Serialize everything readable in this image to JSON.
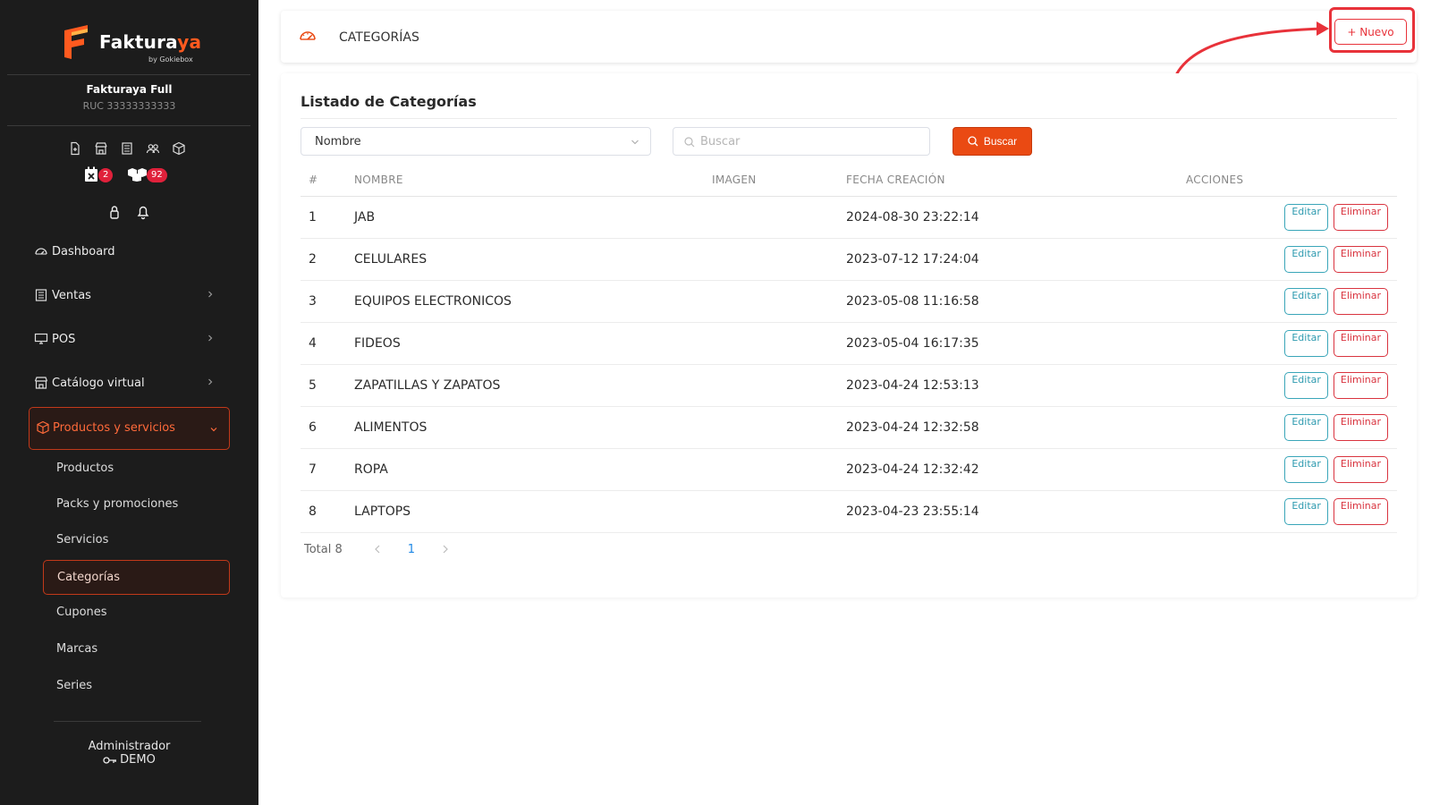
{
  "brand": {
    "name_main": "Faktura",
    "name_accent": "ya",
    "byline": "by Gokiebox",
    "colors": {
      "accent": "#ea4a13",
      "danger": "#e8323a",
      "info": "#2d9aaf",
      "sidebar_bg": "#1c1c1c"
    }
  },
  "company": {
    "name": "Fakturaya Full",
    "ruc": "RUC 33333333333"
  },
  "quick_icons": [
    "file-plus-icon",
    "store-icon",
    "receipt-icon",
    "users-icon",
    "box-icon"
  ],
  "badges": [
    {
      "icon": "calendar-x-icon",
      "count": "2"
    },
    {
      "icon": "boxes-icon",
      "count": "92"
    }
  ],
  "mini_icons": [
    "lock-icon",
    "bell-icon"
  ],
  "nav": {
    "dashboard": "Dashboard",
    "ventas": "Ventas",
    "pos": "POS",
    "catalogo": "Catálogo virtual",
    "productos_servicios": "Productos y servicios",
    "sub": {
      "productos": "Productos",
      "packs": "Packs y promociones",
      "servicios": "Servicios",
      "categorias": "Categorías",
      "cupones": "Cupones",
      "marcas": "Marcas",
      "series": "Series"
    }
  },
  "user": {
    "role": "Administrador",
    "name": "DEMO"
  },
  "header": {
    "title": "CATEGORÍAS",
    "new_button": "+ Nuevo"
  },
  "list": {
    "title": "Listado de Categorías",
    "filter_select": "Nombre",
    "search_placeholder": "Buscar",
    "search_button": "Buscar",
    "columns": {
      "idx": "#",
      "name": "NOMBRE",
      "image": "IMAGEN",
      "date": "FECHA CREACIÓN",
      "actions": "ACCIONES"
    },
    "edit_label": "Editar",
    "delete_label": "Eliminar",
    "rows": [
      {
        "idx": "1",
        "name": "JAB",
        "date": "2024-08-30 23:22:14"
      },
      {
        "idx": "2",
        "name": "CELULARES",
        "date": "2023-07-12 17:24:04"
      },
      {
        "idx": "3",
        "name": "EQUIPOS ELECTRONICOS",
        "date": "2023-05-08 11:16:58"
      },
      {
        "idx": "4",
        "name": "FIDEOS",
        "date": "2023-05-04 16:17:35"
      },
      {
        "idx": "5",
        "name": "ZAPATILLAS Y ZAPATOS",
        "date": "2023-04-24 12:53:13"
      },
      {
        "idx": "6",
        "name": "ALIMENTOS",
        "date": "2023-04-24 12:32:58"
      },
      {
        "idx": "7",
        "name": "ROPA",
        "date": "2023-04-24 12:32:42"
      },
      {
        "idx": "8",
        "name": "LAPTOPS",
        "date": "2023-04-23 23:55:14"
      }
    ],
    "pagination": {
      "total": "Total 8",
      "current_page": "1"
    }
  }
}
